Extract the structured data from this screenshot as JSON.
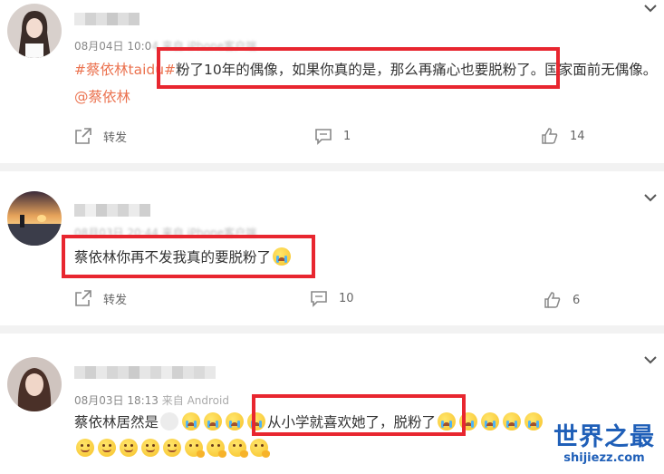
{
  "posts": [
    {
      "meta": "08月04日 10:0",
      "meta_blur": "4 来自 iPhone客户端",
      "topic": "#蔡依林taidu",
      "topic_tail": "#",
      "text_highlight": "粉了10年的偶像，如果你真的是，那么再痛心也要脱粉了。",
      "text_rest": "国家面前无偶像。",
      "mention": "@蔡依林",
      "repost": "转发",
      "comments": "1",
      "likes": "14"
    },
    {
      "meta": "08月03日 20:44",
      "meta_blur": " 来自 iPhone客户端",
      "text_highlight": "蔡依林你再不发我真的要脱粉了",
      "repost": "转发",
      "comments": "10",
      "likes": "6"
    },
    {
      "meta": "08月03日 18:13",
      "meta_blur": " 来自 Android",
      "text_before": "蔡依林居然是",
      "text_highlight": "从小学就喜欢她了，脱粉了"
    }
  ],
  "icons": {
    "expand": "chevron-down-icon",
    "repost": "share-icon",
    "comment": "comment-icon",
    "like": "thumbs-up-icon"
  },
  "colors": {
    "accent": "#eb7350",
    "highlight": "#e8262f",
    "watermark": "#1f5fb8"
  },
  "watermark": {
    "title": "世界之最",
    "url": "shijiezz.com"
  }
}
